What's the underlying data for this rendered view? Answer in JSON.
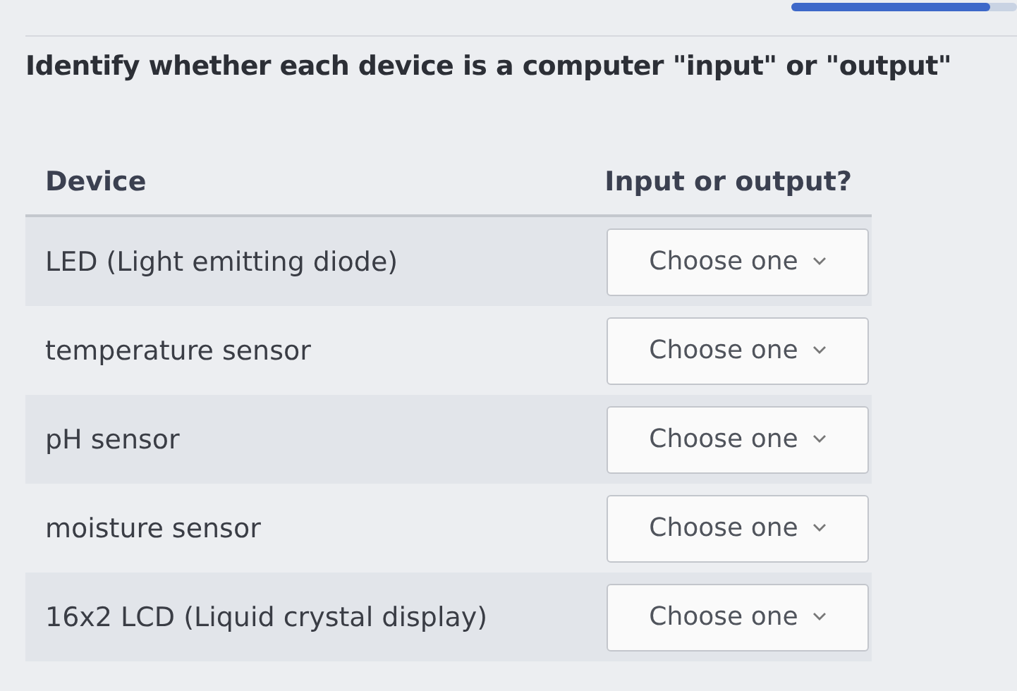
{
  "progress": {
    "level": 0.88
  },
  "question": "Identify whether each device is a computer \"input\" or \"output\"",
  "table": {
    "columns": [
      "Device",
      "Input or output?"
    ],
    "rows": [
      {
        "device": "LED (Light emitting diode)",
        "answer": "Choose one"
      },
      {
        "device": "temperature sensor",
        "answer": "Choose one"
      },
      {
        "device": "pH sensor",
        "answer": "Choose one"
      },
      {
        "device": "moisture sensor",
        "answer": "Choose one"
      },
      {
        "device": "16x2 LCD (Liquid crystal display)",
        "answer": "Choose one"
      }
    ]
  }
}
